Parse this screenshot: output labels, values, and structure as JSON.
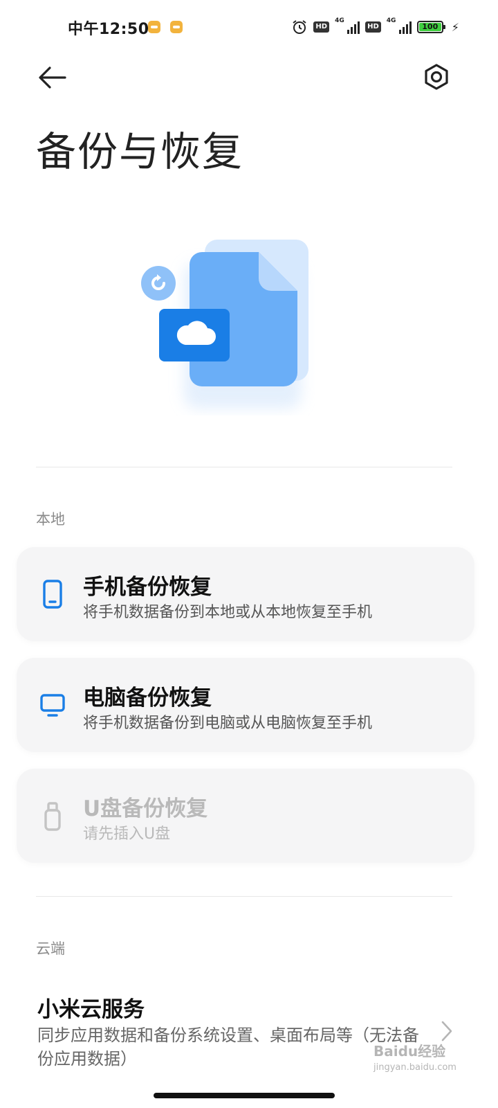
{
  "status_bar": {
    "time": "中午12:50",
    "hd_label": "HD",
    "network_label": "4G",
    "battery_level": "100",
    "battery_fraction": 1.0
  },
  "header": {
    "title": "备份与恢复"
  },
  "local_section": {
    "label": "本地",
    "items": [
      {
        "title": "手机备份恢复",
        "subtitle": "将手机数据备份到本地或从本地恢复至手机",
        "icon": "phone-icon",
        "enabled": true
      },
      {
        "title": "电脑备份恢复",
        "subtitle": "将手机数据备份到电脑或从电脑恢复至手机",
        "icon": "computer-icon",
        "enabled": true
      },
      {
        "title": "U盘备份恢复",
        "subtitle": "请先插入U盘",
        "icon": "usb-drive-icon",
        "enabled": false
      }
    ]
  },
  "cloud_section": {
    "label": "云端",
    "item": {
      "title": "小米云服务",
      "description": "同步应用数据和备份系统设置、桌面布局等（无法备份应用数据）"
    }
  },
  "watermark": {
    "text": "Baidu经验",
    "sub": "jingyan.baidu.com"
  },
  "colors": {
    "accent_blue": "#1a7ee6",
    "illustration_blue": "#6aaef7",
    "card_bg": "#f5f5f6",
    "disabled_text": "#b9b9b9"
  }
}
